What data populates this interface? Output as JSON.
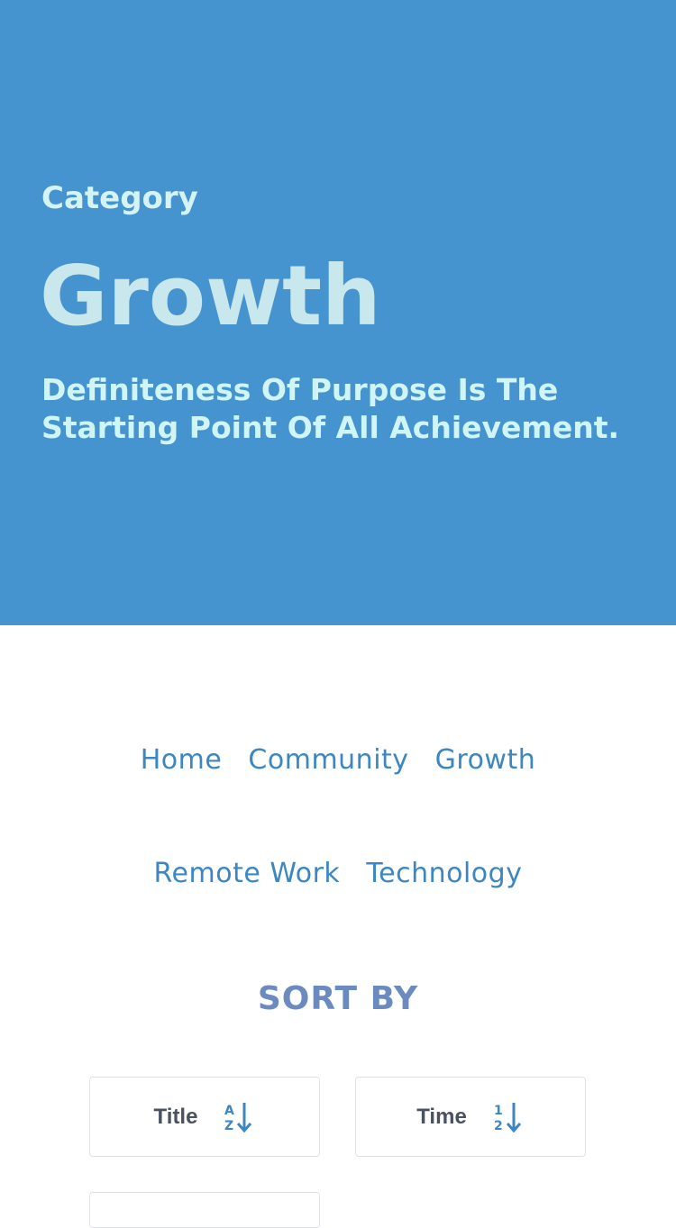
{
  "hero": {
    "kicker": "Category",
    "title": "Growth",
    "quote": "Definiteness Of Purpose Is The Starting Point Of All Achievement.",
    "background_color": "#4594cf"
  },
  "nav": {
    "row1": [
      "Home",
      "Community",
      "Growth"
    ],
    "row2": [
      "Remote Work",
      "Technology"
    ],
    "link_color": "#3c86c2"
  },
  "sort": {
    "heading": "SORT BY",
    "buttons": [
      {
        "label": "Title",
        "icon": "sort-alpha-down-icon"
      },
      {
        "label": "Time",
        "icon": "sort-numeric-down-icon"
      }
    ]
  }
}
